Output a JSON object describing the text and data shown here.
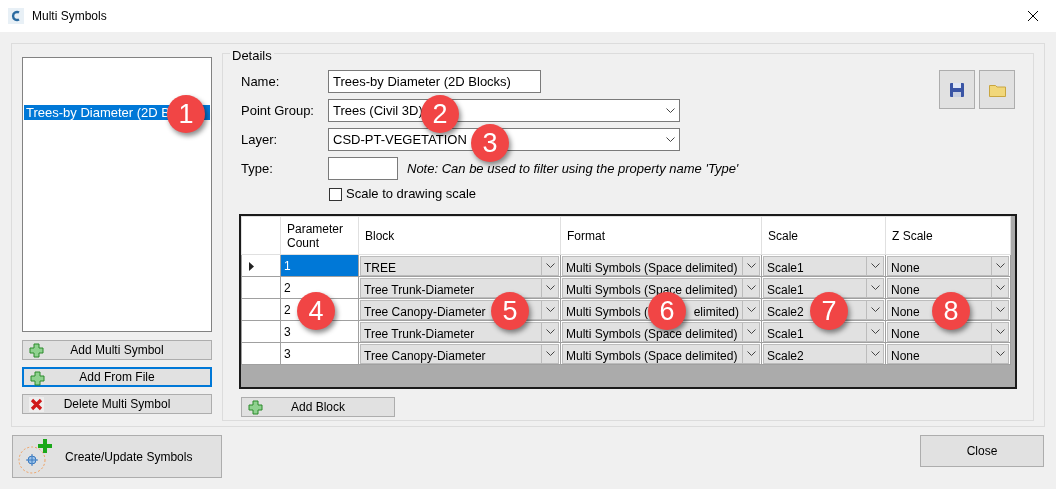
{
  "window": {
    "title": "Multi Symbols"
  },
  "symbols": [
    {
      "label": "Trees-by Diameter (2D B",
      "selected": true
    }
  ],
  "list_buttons": [
    {
      "label": "Add Multi Symbol",
      "kind": "add",
      "focused": false
    },
    {
      "label": "Add From File",
      "kind": "add",
      "focused": true
    },
    {
      "label": "Delete Multi Symbol",
      "kind": "delete",
      "focused": false
    }
  ],
  "details": {
    "title": "Details",
    "fields": [
      {
        "label": "Name:",
        "kind": "text",
        "value": "Trees-by Diameter (2D Blocks)"
      },
      {
        "label": "Point Group:",
        "kind": "dropdown",
        "value": "Trees (Civil 3D)"
      },
      {
        "label": "Layer:",
        "kind": "dropdown",
        "value": "CSD-PT-VEGETATION"
      },
      {
        "label": "Type:",
        "kind": "short",
        "note": "Note: Can be used to filter using the property name 'Type'"
      }
    ],
    "scale_checkbox": {
      "label": "Scale to drawing scale",
      "checked": false
    }
  },
  "grid": {
    "columns": [
      "Parameter Count",
      "Block",
      "Format",
      "Scale",
      "Z Scale"
    ],
    "rows": [
      {
        "current": true,
        "selected": true,
        "count": "1",
        "block": "TREE",
        "format": "Multi Symbols (Space delimited)",
        "scale": "Scale1",
        "z_scale": "None"
      },
      {
        "current": false,
        "selected": false,
        "count": "2",
        "block": "Tree Trunk-Diameter",
        "format": "Multi Symbols (Space delimited)",
        "scale": "Scale1",
        "z_scale": "None"
      },
      {
        "current": false,
        "selected": false,
        "count": "2",
        "block": "Tree Canopy-Diameter",
        "format": "Multi Symbols (",
        "format_after_callout": "elimited)",
        "scale": "Scale2",
        "z_scale": "None"
      },
      {
        "current": false,
        "selected": false,
        "count": "3",
        "block": "Tree Trunk-Diameter",
        "format": "Multi Symbols (Space delimited)",
        "scale": "Scale1",
        "z_scale": "None"
      },
      {
        "current": false,
        "selected": false,
        "count": "3",
        "block": "Tree Canopy-Diameter",
        "format": "Multi Symbols (Space delimited)",
        "scale": "Scale2",
        "z_scale": "None"
      }
    ]
  },
  "add_block_button": "Add Block",
  "create_button": "Create/Update Symbols",
  "close_button": "Close",
  "markers": [
    "1",
    "2",
    "3",
    "4",
    "5",
    "6",
    "7",
    "8"
  ]
}
